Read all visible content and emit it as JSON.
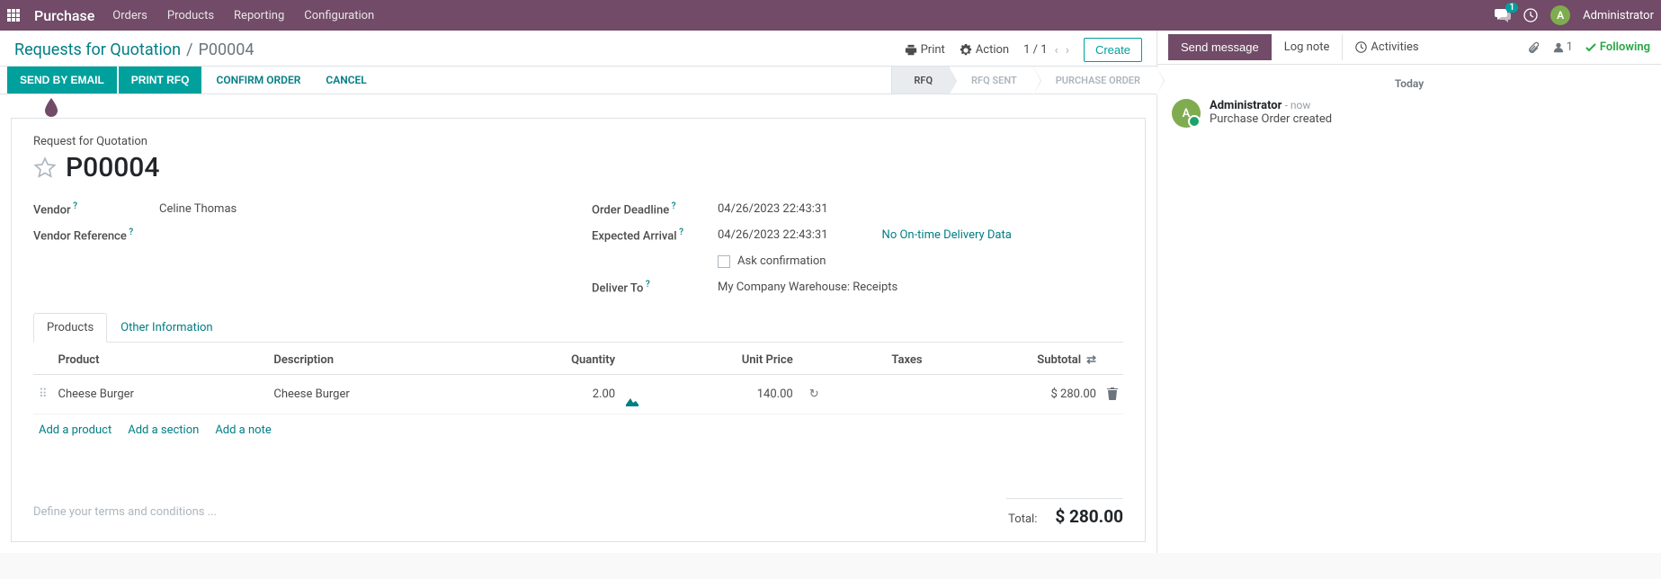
{
  "topbar": {
    "brand": "Purchase",
    "menu": [
      "Orders",
      "Products",
      "Reporting",
      "Configuration"
    ],
    "chat_count": "1",
    "user_initial": "A",
    "user_name": "Administrator"
  },
  "breadcrumb": {
    "root": "Requests for Quotation",
    "sep": "/",
    "current": "P00004"
  },
  "controls": {
    "print": "Print",
    "action": "Action",
    "pager": "1 / 1",
    "create": "Create"
  },
  "statusbar": {
    "send_email": "Send by Email",
    "print_rfq": "Print RFQ",
    "confirm": "Confirm Order",
    "cancel": "Cancel",
    "stages": [
      "RFQ",
      "RFQ Sent",
      "Purchase Order"
    ]
  },
  "sheet": {
    "title": "Request for Quotation",
    "name": "P00004",
    "vendor_label": "Vendor",
    "vendor": "Celine Thomas",
    "vendor_ref_label": "Vendor Reference",
    "deadline_label": "Order Deadline",
    "deadline": "04/26/2023 22:43:31",
    "arrival_label": "Expected Arrival",
    "arrival": "04/26/2023 22:43:31",
    "no_delivery": "No On-time Delivery Data",
    "ask_conf": "Ask confirmation",
    "deliver_label": "Deliver To",
    "deliver": "My Company Warehouse: Receipts"
  },
  "tabs": {
    "products": "Products",
    "other": "Other Information"
  },
  "table": {
    "headers": {
      "product": "Product",
      "description": "Description",
      "qty": "Quantity",
      "unit": "Unit Price",
      "taxes": "Taxes",
      "subtotal": "Subtotal"
    },
    "rows": [
      {
        "product": "Cheese Burger",
        "description": "Cheese Burger",
        "qty": "2.00",
        "unit": "140.00",
        "taxes": "",
        "subtotal": "$ 280.00"
      }
    ],
    "add_product": "Add a product",
    "add_section": "Add a section",
    "add_note": "Add a note"
  },
  "footer": {
    "terms_placeholder": "Define your terms and conditions ...",
    "total_label": "Total:",
    "total": "$ 280.00"
  },
  "chatter": {
    "send": "Send message",
    "lognote": "Log note",
    "activities": "Activities",
    "followers": "1",
    "following": "Following",
    "today": "Today",
    "msg": {
      "initial": "A",
      "author": "Administrator",
      "time": "- now",
      "body": "Purchase Order created"
    }
  }
}
